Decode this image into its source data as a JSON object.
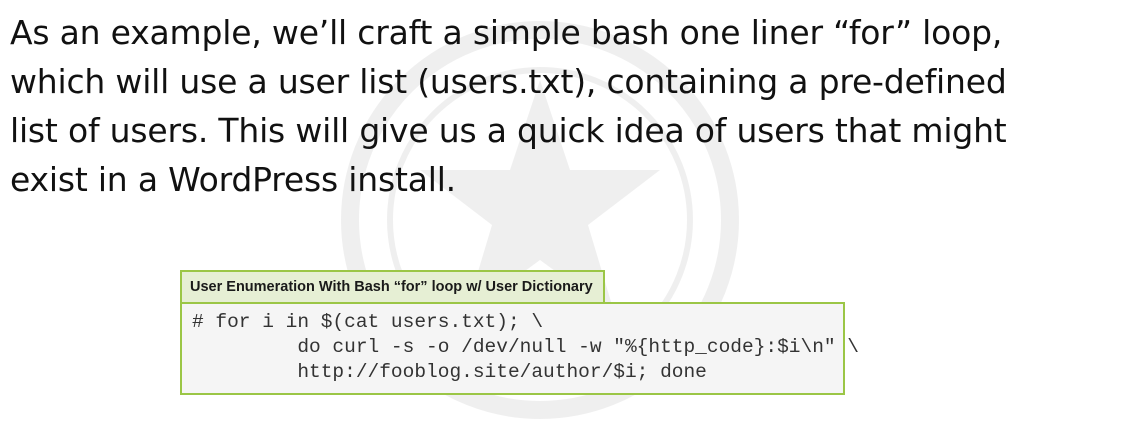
{
  "paragraph": {
    "line1": "As an example, we’ll craft a simple bash one liner “for” loop,",
    "line2": "which will use a user list (users.txt), containing a pre-defined",
    "line3": "list of users. This will give us a quick idea of users that might",
    "line4": "exist in a WordPress install."
  },
  "code_block": {
    "title": "User Enumeration With Bash “for” loop w/ User Dictionary",
    "lines": [
      "# for i in $(cat users.txt); \\",
      "         do curl -s -o /dev/null -w \"%{http_code}:$i\\n\" \\",
      "         http://fooblog.site/author/$i; done"
    ]
  },
  "colors": {
    "accent_border": "#9bc646",
    "title_background": "#e6efd4",
    "code_background": "#f5f5f5"
  }
}
